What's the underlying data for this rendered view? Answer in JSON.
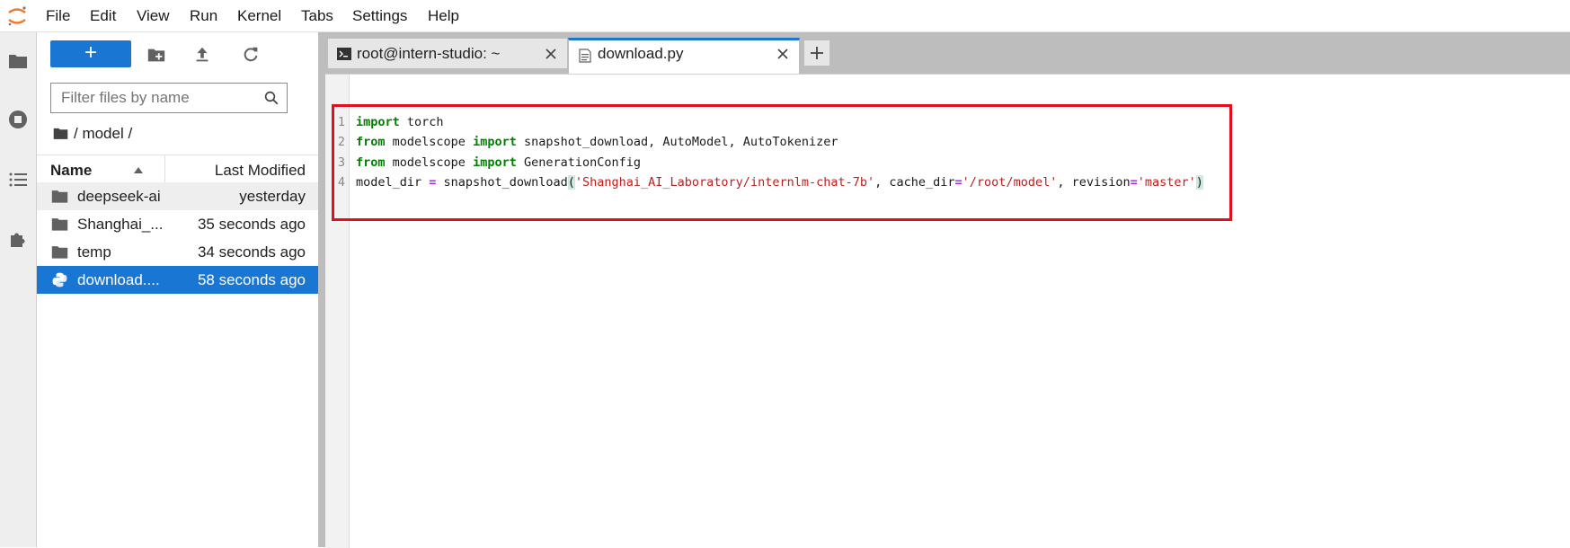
{
  "menu": [
    "File",
    "Edit",
    "View",
    "Run",
    "Kernel",
    "Tabs",
    "Settings",
    "Help"
  ],
  "sidebar": {
    "new_label": "+",
    "filter_placeholder": "Filter files by name",
    "breadcrumb": "/ model /",
    "columns": {
      "name": "Name",
      "modified": "Last Modified"
    },
    "files": [
      {
        "name": "deepseek-ai",
        "modified": "yesterday",
        "type": "folder"
      },
      {
        "name": "Shanghai_...",
        "modified": "35 seconds ago",
        "type": "folder"
      },
      {
        "name": "temp",
        "modified": "34 seconds ago",
        "type": "folder"
      },
      {
        "name": "download....",
        "modified": "58 seconds ago",
        "type": "python",
        "selected": true
      }
    ]
  },
  "tabs": [
    {
      "label": "root@intern-studio: ~",
      "icon": "terminal-icon",
      "active": false
    },
    {
      "label": "download.py",
      "icon": "file-icon",
      "active": true
    }
  ],
  "editor": {
    "line_numbers": [
      "1",
      "2",
      "3",
      "4"
    ],
    "lines": {
      "l1": {
        "kw1": "import",
        "t1": " torch"
      },
      "l2": {
        "kw1": "from",
        "t1": " modelscope ",
        "kw2": "import",
        "t2": " snapshot_download, AutoModel, AutoTokenizer"
      },
      "l3": {
        "kw1": "from",
        "t1": " modelscope ",
        "kw2": "import",
        "t2": " GenerationConfig"
      },
      "l4": {
        "t1": "model_dir ",
        "op1": "=",
        "t2": " snapshot_download",
        "b1": "(",
        "s1": "'Shanghai_AI_Laboratory/internlm-chat-7b'",
        "t3": ", cache_dir",
        "op2": "=",
        "s2": "'/root/model'",
        "t4": ", revision",
        "op3": "=",
        "s3": "'master'",
        "b2": ")"
      }
    }
  },
  "colors": {
    "accent": "#1976d2",
    "keyword": "#008000",
    "string": "#ba2121",
    "operator": "#aa22ff",
    "highlight": "#e0101c"
  }
}
